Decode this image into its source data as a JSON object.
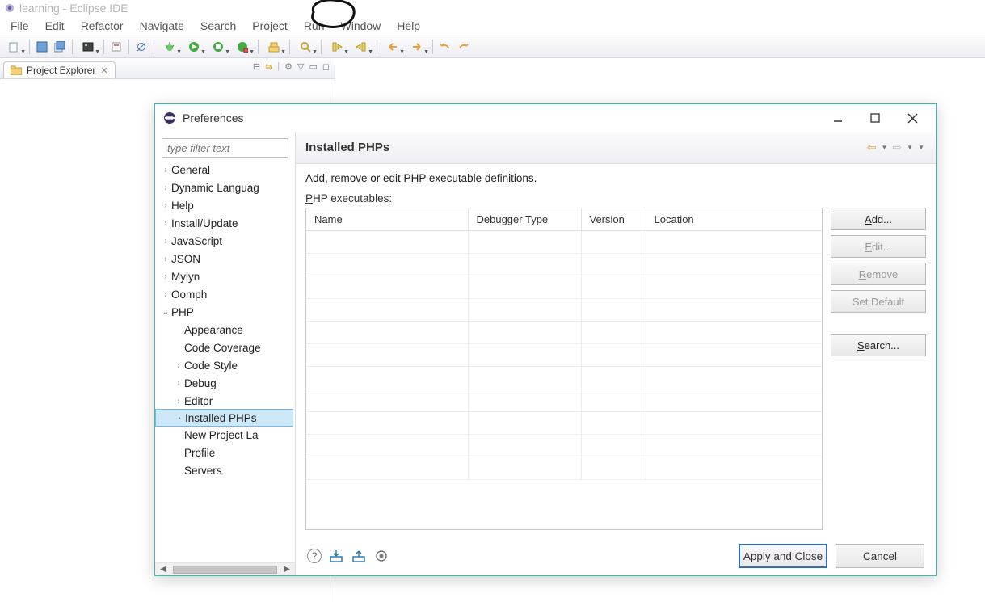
{
  "title": "learning - Eclipse IDE",
  "menubar": [
    "File",
    "Edit",
    "Refactor",
    "Navigate",
    "Search",
    "Project",
    "Run",
    "Window",
    "Help"
  ],
  "projectExplorer": {
    "tabLabel": "Project Explorer"
  },
  "preferences": {
    "title": "Preferences",
    "filterPlaceholder": "type filter text",
    "tree": [
      {
        "label": "General",
        "level": 0,
        "expand": ">"
      },
      {
        "label": "Dynamic Languag",
        "level": 0,
        "expand": ">"
      },
      {
        "label": "Help",
        "level": 0,
        "expand": ">"
      },
      {
        "label": "Install/Update",
        "level": 0,
        "expand": ">"
      },
      {
        "label": "JavaScript",
        "level": 0,
        "expand": ">"
      },
      {
        "label": "JSON",
        "level": 0,
        "expand": ">"
      },
      {
        "label": "Mylyn",
        "level": 0,
        "expand": ">"
      },
      {
        "label": "Oomph",
        "level": 0,
        "expand": ">"
      },
      {
        "label": "PHP",
        "level": 0,
        "expand": "v"
      },
      {
        "label": "Appearance",
        "level": 1,
        "expand": ""
      },
      {
        "label": "Code Coverage",
        "level": 1,
        "expand": ""
      },
      {
        "label": "Code Style",
        "level": 1,
        "expand": ">"
      },
      {
        "label": "Debug",
        "level": 1,
        "expand": ">"
      },
      {
        "label": "Editor",
        "level": 1,
        "expand": ">"
      },
      {
        "label": "Installed PHPs",
        "level": 1,
        "expand": ">",
        "selected": true
      },
      {
        "label": "New Project La",
        "level": 1,
        "expand": ""
      },
      {
        "label": "Profile",
        "level": 1,
        "expand": ""
      },
      {
        "label": "Servers",
        "level": 1,
        "expand": ""
      }
    ],
    "page": {
      "heading": "Installed PHPs",
      "description": "Add, remove or edit PHP executable definitions.",
      "listLabelPrefix": "P",
      "listLabelRest": "HP executables:",
      "columns": [
        "Name",
        "Debugger Type",
        "Version",
        "Location"
      ],
      "buttons": {
        "add": "Add...",
        "edit": "Edit...",
        "remove": "Remove",
        "setDefault": "Set Default",
        "search": "Search..."
      }
    },
    "footer": {
      "apply": "Apply and Close",
      "cancel": "Cancel"
    }
  }
}
